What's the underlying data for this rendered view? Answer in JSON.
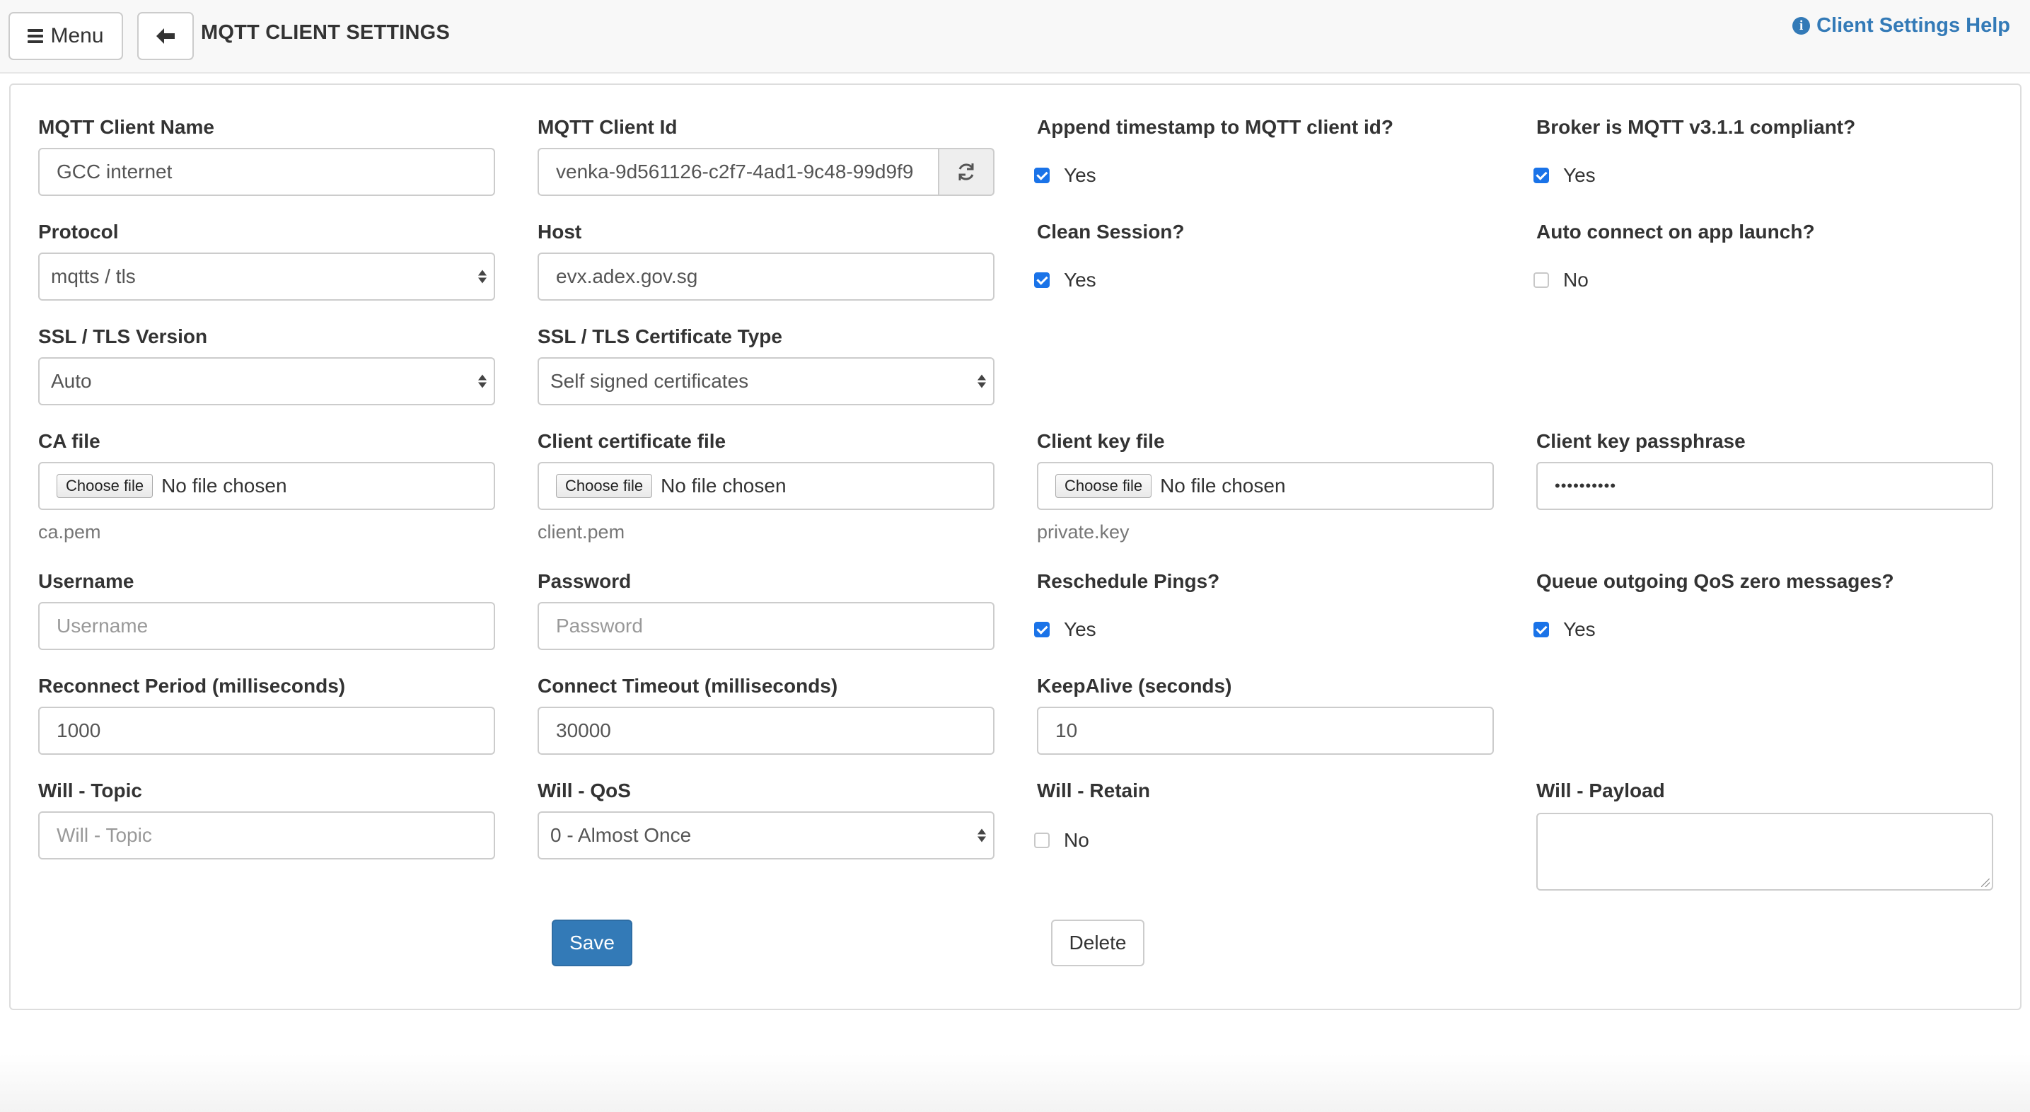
{
  "header": {
    "menu_label": "Menu",
    "title": "MQTT CLIENT SETTINGS",
    "help_label": "Client Settings Help"
  },
  "fields": {
    "client_name": {
      "label": "MQTT Client Name",
      "value": "GCC internet"
    },
    "client_id": {
      "label": "MQTT Client Id",
      "value": "venka-9d561126-c2f7-4ad1-9c48-99d9f9"
    },
    "append_timestamp": {
      "label": "Append timestamp to MQTT client id?",
      "option": "Yes",
      "checked": true
    },
    "broker_compliant": {
      "label": "Broker is MQTT v3.1.1 compliant?",
      "option": "Yes",
      "checked": true
    },
    "protocol": {
      "label": "Protocol",
      "value": "mqtts / tls"
    },
    "host": {
      "label": "Host",
      "value": "evx.adex.gov.sg"
    },
    "clean_session": {
      "label": "Clean Session?",
      "option": "Yes",
      "checked": true
    },
    "auto_connect": {
      "label": "Auto connect on app launch?",
      "option": "No",
      "checked": false
    },
    "ssl_version": {
      "label": "SSL / TLS Version",
      "value": "Auto"
    },
    "cert_type": {
      "label": "SSL / TLS Certificate Type",
      "value": "Self signed certificates"
    },
    "ca_file": {
      "label": "CA file",
      "button": "Choose file",
      "status": "No file chosen",
      "current": "ca.pem"
    },
    "client_cert_file": {
      "label": "Client certificate file",
      "button": "Choose file",
      "status": "No file chosen",
      "current": "client.pem"
    },
    "client_key_file": {
      "label": "Client key file",
      "button": "Choose file",
      "status": "No file chosen",
      "current": "private.key"
    },
    "key_passphrase": {
      "label": "Client key passphrase",
      "value": "••••••••••"
    },
    "username": {
      "label": "Username",
      "placeholder": "Username"
    },
    "password": {
      "label": "Password",
      "placeholder": "Password"
    },
    "reschedule_pings": {
      "label": "Reschedule Pings?",
      "option": "Yes",
      "checked": true
    },
    "queue_qos_zero": {
      "label": "Queue outgoing QoS zero messages?",
      "option": "Yes",
      "checked": true
    },
    "reconnect_period": {
      "label": "Reconnect Period (milliseconds)",
      "value": "1000"
    },
    "connect_timeout": {
      "label": "Connect Timeout (milliseconds)",
      "value": "30000"
    },
    "keepalive": {
      "label": "KeepAlive (seconds)",
      "value": "10"
    },
    "will_topic": {
      "label": "Will - Topic",
      "placeholder": "Will - Topic"
    },
    "will_qos": {
      "label": "Will - QoS",
      "value": "0 - Almost Once"
    },
    "will_retain": {
      "label": "Will - Retain",
      "option": "No",
      "checked": false
    },
    "will_payload": {
      "label": "Will - Payload",
      "value": ""
    }
  },
  "actions": {
    "save_label": "Save",
    "delete_label": "Delete"
  },
  "colors": {
    "primary": "#337ab7",
    "checkbox": "#1a73e8",
    "border": "#cccccc"
  }
}
